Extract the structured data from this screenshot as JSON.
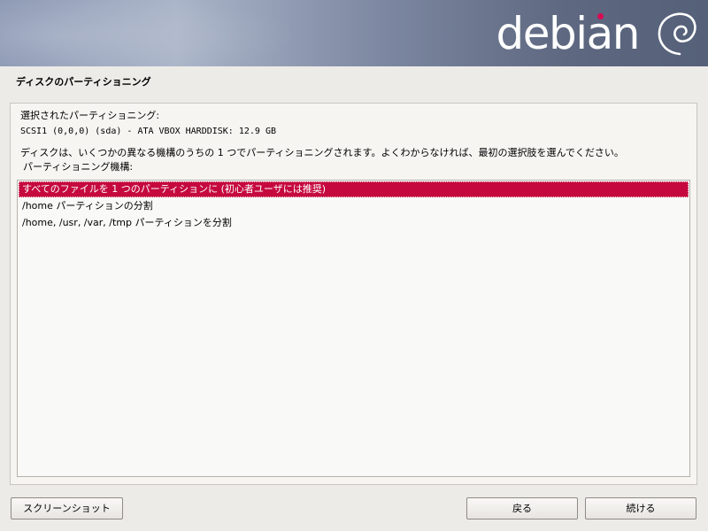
{
  "banner": {
    "logo_text": "debian"
  },
  "page": {
    "title": "ディスクのパーティショニング"
  },
  "content": {
    "selected_label": "選択されたパーティショニング:",
    "disk": "SCSI1 (0,0,0) (sda) - ATA VBOX HARDDISK: 12.9 GB",
    "description": "ディスクは、いくつかの異なる機構のうちの 1 つでパーティショニングされます。よくわからなければ、最初の選択肢を選んでください。",
    "scheme_label": "パーティショニング機構:"
  },
  "options": [
    {
      "label": "すべてのファイルを 1 つのパーティションに (初心者ユーザには推奨)",
      "selected": true
    },
    {
      "label": "/home パーティションの分割",
      "selected": false
    },
    {
      "label": "/home, /usr, /var, /tmp パーティションを分割",
      "selected": false
    }
  ],
  "buttons": {
    "screenshot": "スクリーンショット",
    "back": "戻る",
    "continue": "続ける"
  },
  "colors": {
    "selection": "#c5093f",
    "logo_dot": "#d70a53"
  }
}
